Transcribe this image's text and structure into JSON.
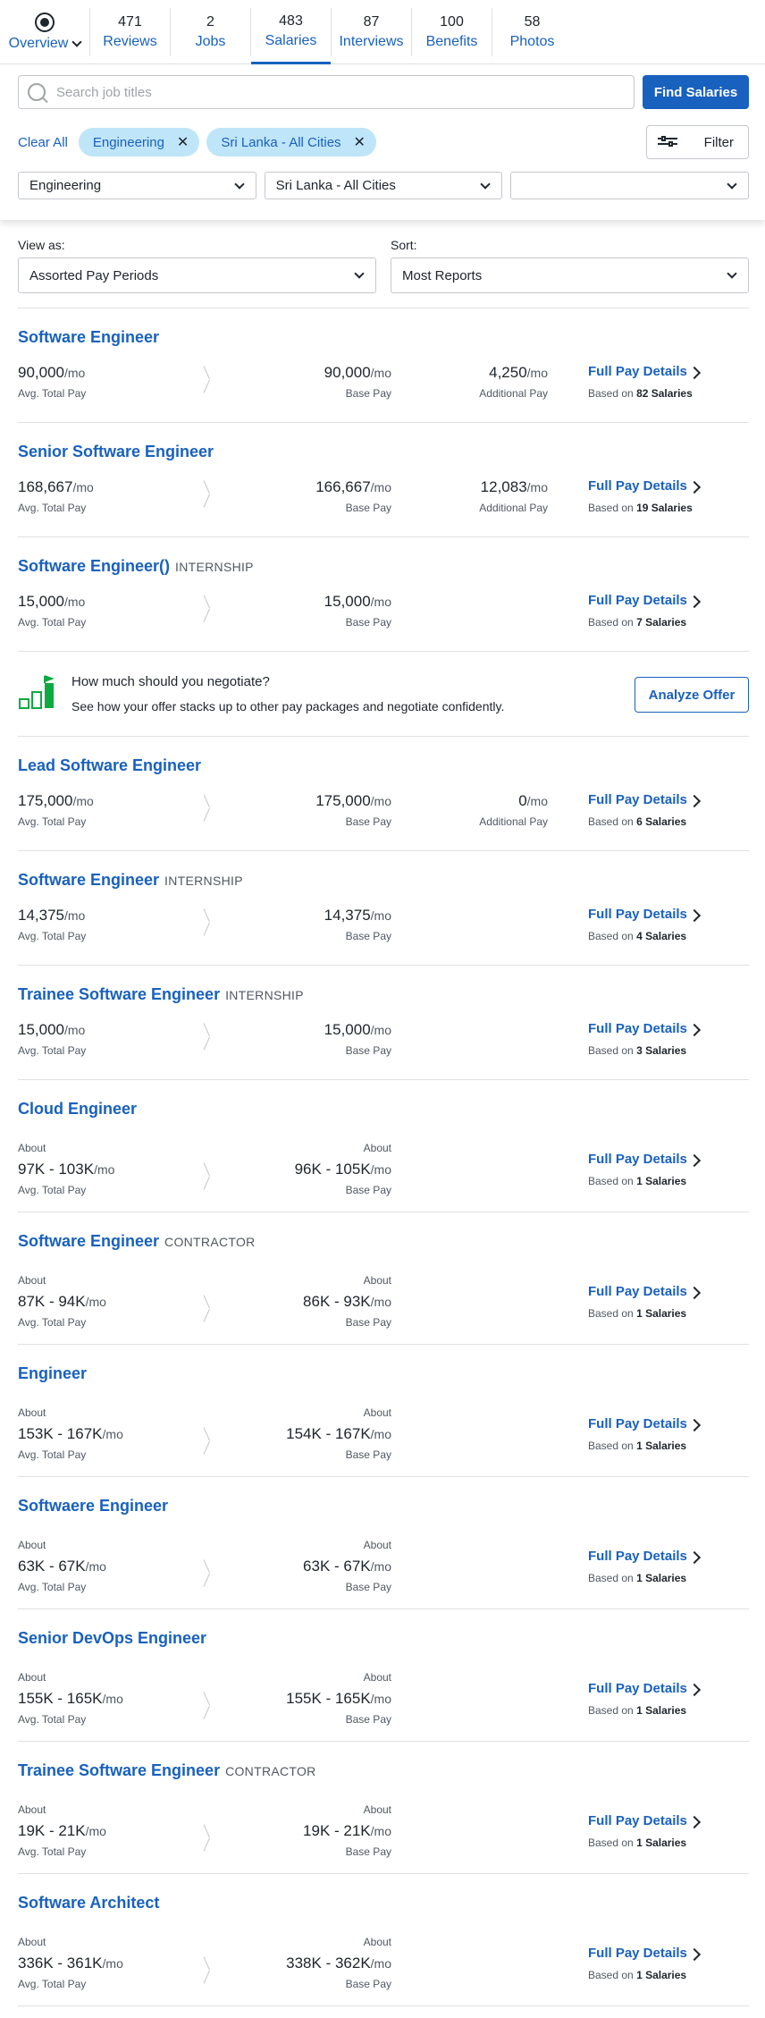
{
  "tabs": [
    {
      "label": "Overview",
      "count": ""
    },
    {
      "label": "Reviews",
      "count": "471"
    },
    {
      "label": "Jobs",
      "count": "2"
    },
    {
      "label": "Salaries",
      "count": "483"
    },
    {
      "label": "Interviews",
      "count": "87"
    },
    {
      "label": "Benefits",
      "count": "100"
    },
    {
      "label": "Photos",
      "count": "58"
    }
  ],
  "search": {
    "placeholder": "Search job titles",
    "button": "Find Salaries"
  },
  "filters": {
    "clear_all": "Clear All",
    "chips": [
      "Engineering",
      "Sri Lanka - All Cities"
    ],
    "filter_button": "Filter",
    "dropdowns": [
      "Engineering",
      "Sri Lanka - All Cities",
      ""
    ]
  },
  "view": {
    "view_label": "View as:",
    "view_value": "Assorted Pay Periods",
    "sort_label": "Sort:",
    "sort_value": "Most Reports"
  },
  "labels": {
    "avg_total": "Avg. Total Pay",
    "base": "Base Pay",
    "additional": "Additional Pay",
    "about": "About",
    "full_pay": "Full Pay Details",
    "based_on": "Based on",
    "per_mo": "/mo"
  },
  "negotiate": {
    "question": "How much should you negotiate?",
    "description": "See how your offer stacks up to other pay packages and negotiate confidently.",
    "button": "Analyze Offer"
  },
  "salaries": [
    {
      "title": "Software Engineer",
      "type": "",
      "total": "90,000",
      "base": "90,000",
      "additional": "4,250",
      "reports": "82 Salaries"
    },
    {
      "title": "Senior Software Engineer",
      "type": "",
      "total": "168,667",
      "base": "166,667",
      "additional": "12,083",
      "reports": "19 Salaries"
    },
    {
      "title": "Software Engineer()",
      "type": "INTERNSHIP",
      "total": "15,000",
      "base": "15,000",
      "additional": "",
      "reports": "7 Salaries"
    },
    {
      "title": "Lead Software Engineer",
      "type": "",
      "total": "175,000",
      "base": "175,000",
      "additional": "0",
      "reports": "6 Salaries"
    },
    {
      "title": "Software Engineer",
      "type": "INTERNSHIP",
      "total": "14,375",
      "base": "14,375",
      "additional": "",
      "reports": "4 Salaries"
    },
    {
      "title": "Trainee Software Engineer",
      "type": "INTERNSHIP",
      "total": "15,000",
      "base": "15,000",
      "additional": "",
      "reports": "3 Salaries"
    },
    {
      "title": "Cloud Engineer",
      "type": "",
      "total": "97K - 103K",
      "base": "96K - 105K",
      "additional": "",
      "reports": "1 Salaries"
    },
    {
      "title": "Software Engineer",
      "type": "CONTRACTOR",
      "total": "87K - 94K",
      "base": "86K - 93K",
      "additional": "",
      "reports": "1 Salaries"
    },
    {
      "title": "Engineer",
      "type": "",
      "total": "153K - 167K",
      "base": "154K - 167K",
      "additional": "",
      "reports": "1 Salaries"
    },
    {
      "title": "Softwaere Engineer",
      "type": "",
      "total": "63K - 67K",
      "base": "63K - 67K",
      "additional": "",
      "reports": "1 Salaries"
    },
    {
      "title": "Senior DevOps Engineer",
      "type": "",
      "total": "155K - 165K",
      "base": "155K - 165K",
      "additional": "",
      "reports": "1 Salaries"
    },
    {
      "title": "Trainee Software Engineer",
      "type": "CONTRACTOR",
      "total": "19K - 21K",
      "base": "19K - 21K",
      "additional": "",
      "reports": "1 Salaries"
    },
    {
      "title": "Software Architect",
      "type": "",
      "total": "336K - 361K",
      "base": "338K - 362K",
      "additional": "",
      "reports": "1 Salaries"
    }
  ]
}
